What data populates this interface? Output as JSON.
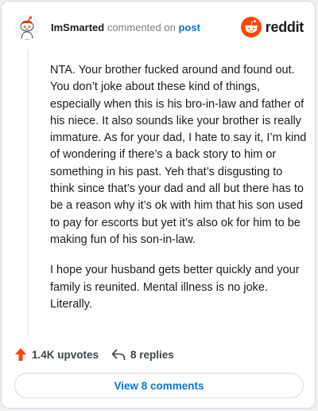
{
  "comment": {
    "username": "ImSmarted",
    "action_text": "commented on",
    "target_link": "post",
    "paragraphs": [
      "NTA. Your brother fucked around and found out. You don’t joke about these kind of things, especially when this is his bro-in-law and father of his niece. It also sounds like your brother is really immature. As for your dad, I hate to say it, I’m kind of wondering if there’s a back story to him or something in his past. Yeh that’s disgusting to think since that’s your dad and all but there has to be a reason why it’s ok with him that his son used to pay for escorts but yet it’s also ok for him to be making fun of his son-in-law.",
      "I hope your husband gets better quickly and your family is reunited. Mental illness is no joke. Literally."
    ]
  },
  "brand": {
    "name": "reddit",
    "icon": "reddit-logo-icon",
    "color": "#ff4500"
  },
  "avatar": {
    "icon": "snoo-avatar-icon"
  },
  "actions": {
    "upvotes": "1.4K upvotes",
    "replies": "8 replies",
    "upvote_icon": "upvote-arrow-icon",
    "reply_icon": "reply-arrow-icon"
  },
  "footer": {
    "view_comments": "View 8 comments"
  },
  "colors": {
    "link": "#0079d3",
    "accent": "#ff4500",
    "text": "#1c1c1c"
  }
}
